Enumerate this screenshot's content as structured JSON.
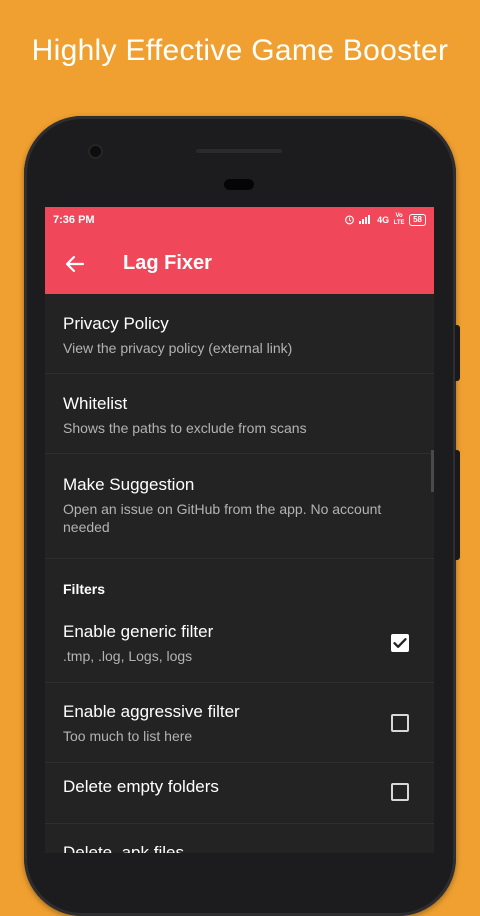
{
  "headline": "Highly Effective Game Booster",
  "status_bar": {
    "time": "7:36 PM",
    "network": "4G",
    "volte": "Vo LTE",
    "battery": "58",
    "icons": [
      "alarm-icon",
      "signal-icon",
      "volte-icon",
      "battery-icon"
    ]
  },
  "app_bar": {
    "title": "Lag Fixer",
    "back_icon": "arrow-left-icon"
  },
  "preferences": [
    {
      "title": "Privacy Policy",
      "summary": "View the privacy policy (external link)"
    },
    {
      "title": "Whitelist",
      "summary": "Shows the paths to exclude from scans"
    },
    {
      "title": "Make Suggestion",
      "summary": "Open an issue on GitHub from the app. No account needed"
    }
  ],
  "filters": {
    "header": "Filters",
    "items": [
      {
        "title": "Enable generic filter",
        "summary": ".tmp, .log, Logs, logs",
        "checked": true
      },
      {
        "title": "Enable aggressive filter",
        "summary": "Too much to list here",
        "checked": false
      },
      {
        "title": "Delete empty folders",
        "checked": false
      },
      {
        "title": "Delete .apk files",
        "checked": true
      }
    ]
  },
  "colors": {
    "background": "#F0A030",
    "accent": "#F0485A",
    "surface": "#232323"
  }
}
